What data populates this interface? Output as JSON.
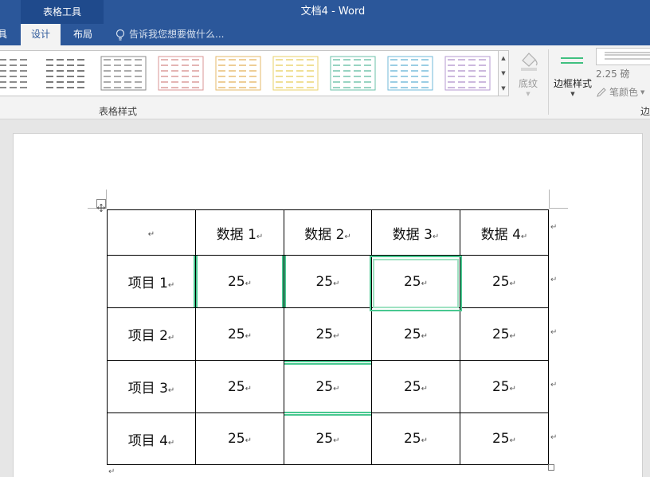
{
  "window": {
    "context_group": "表格工具",
    "title": "文档4 - Word"
  },
  "tabs": {
    "partial": "具",
    "design": "设计",
    "layout": "布局"
  },
  "tell_me": {
    "text": "告诉我您想要做什么..."
  },
  "ribbon": {
    "styles_group_label": "表格样式",
    "shading_label": "底纹",
    "border_style_label": "边框样式",
    "line_weight": "2.25 磅",
    "pen_color_label": "笔颜色",
    "borders_group_label": "边",
    "gallery_colors": [
      "#5a5a5a",
      "#444444",
      "#888888",
      "#d99594",
      "#e6b86a",
      "#ead26a",
      "#6bc2a8",
      "#70b8d8",
      "#b59ad0"
    ]
  },
  "table": {
    "paragraph_mark": "↵",
    "rows": [
      [
        "",
        "数据 1",
        "数据 2",
        "数据 3",
        "数据 4"
      ],
      [
        "项目 1",
        "25",
        "25",
        "25",
        "25"
      ],
      [
        "项目 2",
        "25",
        "25",
        "25",
        "25"
      ],
      [
        "项目 3",
        "25",
        "25",
        "25",
        "25"
      ],
      [
        "项目 4",
        "25",
        "25",
        "25",
        "25"
      ]
    ]
  },
  "colors": {
    "title_bar": "#2b579a",
    "border_highlight": "#48c890"
  }
}
